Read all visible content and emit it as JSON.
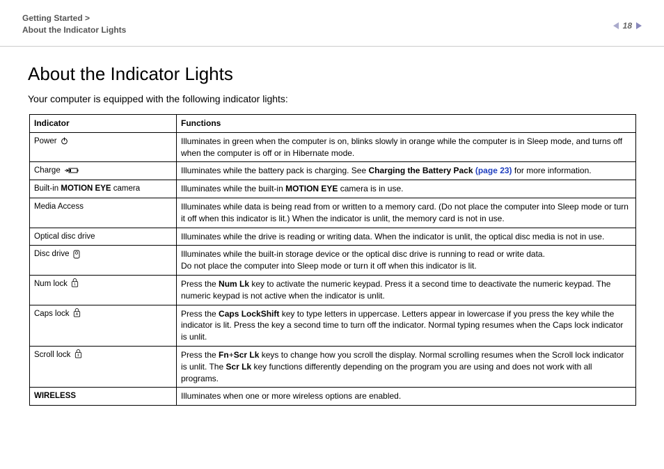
{
  "header": {
    "breadcrumb_line1": "Getting Started >",
    "breadcrumb_line2": "About the Indicator Lights",
    "page_number": "18"
  },
  "title": "About the Indicator Lights",
  "intro": "Your computer is equipped with the following indicator lights:",
  "table": {
    "col_indicator": "Indicator",
    "col_functions": "Functions",
    "rows": [
      {
        "indicator_pre": "Power ",
        "icon": "power",
        "func_pre": "Illuminates in green when the computer is on, blinks slowly in orange while the computer is in Sleep mode, and turns off when the computer is off or in Hibernate mode."
      },
      {
        "indicator_pre": "Charge ",
        "icon": "charge",
        "func_pre": "Illuminates while the battery pack is charging. See ",
        "func_bold": "Charging the Battery Pack ",
        "func_link": "(page 23)",
        "func_post": " for more information."
      },
      {
        "indicator_pre": "Built-in ",
        "indicator_bold": "MOTION EYE",
        "indicator_post": " camera",
        "func_pre": "Illuminates while the built-in ",
        "func_bold": "MOTION EYE",
        "func_post": " camera is in use."
      },
      {
        "indicator_pre": "Media Access",
        "func_pre": "Illuminates while data is being read from or written to a memory card. (Do not place the computer into Sleep mode or turn it off when this indicator is lit.) When the indicator is unlit, the memory card is not in use."
      },
      {
        "indicator_pre": "Optical disc drive",
        "func_pre": "Illuminates while the drive is reading or writing data. When the indicator is unlit, the optical disc media is not in use."
      },
      {
        "indicator_pre": "Disc drive ",
        "icon": "disc",
        "func_pre": "Illuminates while the built-in storage device or the optical disc drive is running to read or write data.",
        "func_br": "Do not place the computer into Sleep mode or turn it off when this indicator is lit."
      },
      {
        "indicator_pre": "Num lock ",
        "icon": "numlock",
        "func_pre": "Press the ",
        "func_bold": "Num Lk",
        "func_post": " key to activate the numeric keypad. Press it a second time to deactivate the numeric keypad. The numeric keypad is not active when the indicator is unlit."
      },
      {
        "indicator_pre": "Caps lock ",
        "icon": "capslock",
        "func_pre": "Press the ",
        "func_bold": "Caps Lock",
        "func_mid": " key to type letters in uppercase. Letters appear in lowercase if you press the ",
        "func_bold2": "Shift",
        "func_post": " key while the indicator is lit. Press the key a second time to turn off the indicator. Normal typing resumes when the Caps lock indicator is unlit."
      },
      {
        "indicator_pre": "Scroll lock ",
        "icon": "scrolllock",
        "func_pre": "Press the ",
        "func_bold": "Fn",
        "func_plus": "+",
        "func_bold2": "Scr Lk",
        "func_mid": " keys to change how you scroll the display. Normal scrolling resumes when the Scroll lock indicator is unlit. The ",
        "func_bold3": "Scr Lk",
        "func_post": " key functions differently depending on the program you are using and does not work with all programs."
      },
      {
        "indicator_bold": "WIRELESS",
        "func_pre": "Illuminates when one or more wireless options are enabled."
      }
    ]
  }
}
